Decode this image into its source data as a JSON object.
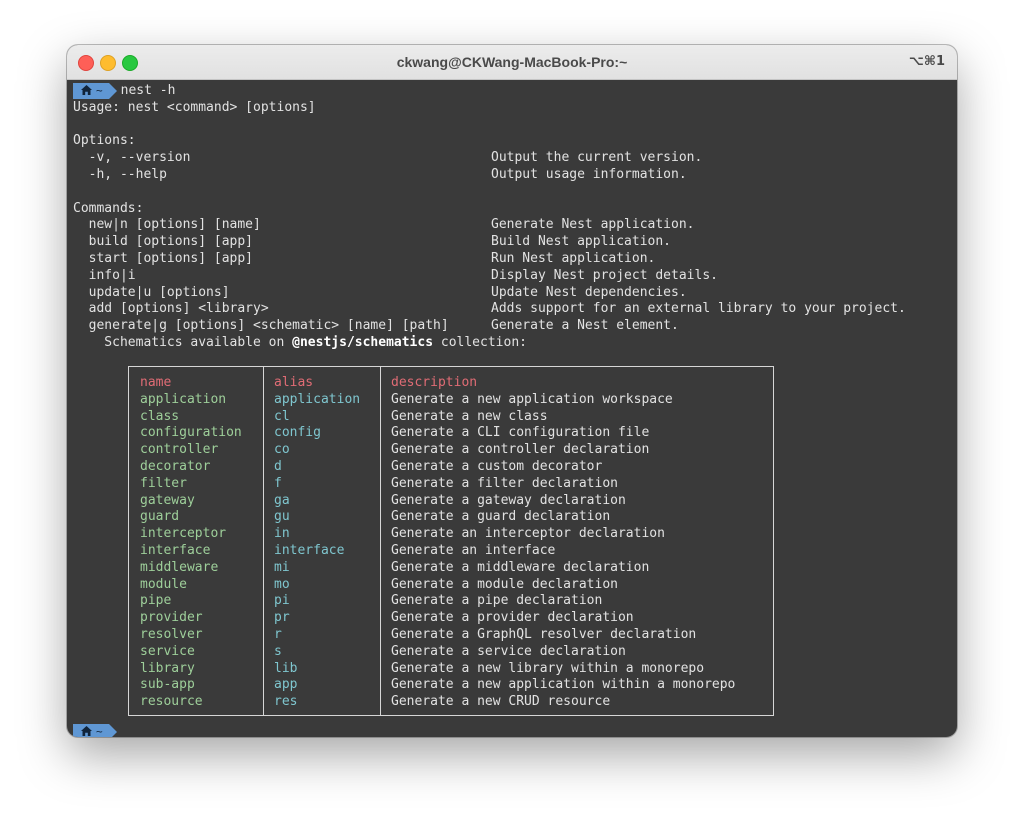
{
  "window": {
    "title": "ckwang@CKWang-MacBook-Pro:~",
    "shortcut": "⌥⌘1"
  },
  "prompt": {
    "tilde": "~",
    "command": "nest -h"
  },
  "usage": "Usage: nest <command> [options]",
  "options": {
    "heading": "Options:",
    "items": [
      {
        "flag": "  -v, --version",
        "desc": "Output the current version."
      },
      {
        "flag": "  -h, --help",
        "desc": "Output usage information."
      }
    ]
  },
  "commands": {
    "heading": "Commands:",
    "items": [
      {
        "cmd": "  new|n [options] [name]",
        "desc": "Generate Nest application."
      },
      {
        "cmd": "  build [options] [app]",
        "desc": "Build Nest application."
      },
      {
        "cmd": "  start [options] [app]",
        "desc": "Run Nest application."
      },
      {
        "cmd": "  info|i",
        "desc": "Display Nest project details."
      },
      {
        "cmd": "  update|u [options]",
        "desc": "Update Nest dependencies."
      },
      {
        "cmd": "  add [options] <library>",
        "desc": "Adds support for an external library to your project."
      },
      {
        "cmd": "  generate|g [options] <schematic> [name] [path]",
        "desc": "Generate a Nest element."
      }
    ]
  },
  "schematics_line": {
    "prefix": "    Schematics available on ",
    "collection": "@nestjs/schematics",
    "suffix": " collection:"
  },
  "schematics_table": {
    "headers": {
      "name": "name",
      "alias": "alias",
      "description": "description"
    },
    "rows": [
      {
        "name": "application",
        "alias": "application",
        "description": "Generate a new application workspace"
      },
      {
        "name": "class",
        "alias": "cl",
        "description": "Generate a new class"
      },
      {
        "name": "configuration",
        "alias": "config",
        "description": "Generate a CLI configuration file"
      },
      {
        "name": "controller",
        "alias": "co",
        "description": "Generate a controller declaration"
      },
      {
        "name": "decorator",
        "alias": "d",
        "description": "Generate a custom decorator"
      },
      {
        "name": "filter",
        "alias": "f",
        "description": "Generate a filter declaration"
      },
      {
        "name": "gateway",
        "alias": "ga",
        "description": "Generate a gateway declaration"
      },
      {
        "name": "guard",
        "alias": "gu",
        "description": "Generate a guard declaration"
      },
      {
        "name": "interceptor",
        "alias": "in",
        "description": "Generate an interceptor declaration"
      },
      {
        "name": "interface",
        "alias": "interface",
        "description": "Generate an interface"
      },
      {
        "name": "middleware",
        "alias": "mi",
        "description": "Generate a middleware declaration"
      },
      {
        "name": "module",
        "alias": "mo",
        "description": "Generate a module declaration"
      },
      {
        "name": "pipe",
        "alias": "pi",
        "description": "Generate a pipe declaration"
      },
      {
        "name": "provider",
        "alias": "pr",
        "description": "Generate a provider declaration"
      },
      {
        "name": "resolver",
        "alias": "r",
        "description": "Generate a GraphQL resolver declaration"
      },
      {
        "name": "service",
        "alias": "s",
        "description": "Generate a service declaration"
      },
      {
        "name": "library",
        "alias": "lib",
        "description": "Generate a new library within a monorepo"
      },
      {
        "name": "sub-app",
        "alias": "app",
        "description": "Generate a new application within a monorepo"
      },
      {
        "name": "resource",
        "alias": "res",
        "description": "Generate a new CRUD resource"
      }
    ]
  },
  "icons": {
    "home": "home-icon"
  },
  "colors": {
    "terminal_bg": "#3a3a3a",
    "prompt_badge": "#5f97d4",
    "header_red": "#e06c75",
    "name_green": "#9ecf9a",
    "alias_cyan": "#7fc6cf"
  }
}
